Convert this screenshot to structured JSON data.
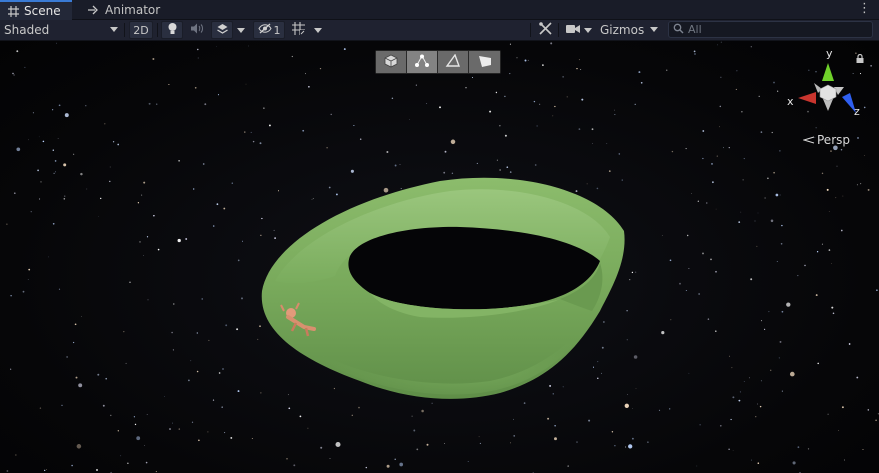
{
  "tabs": [
    {
      "label": "Scene",
      "icon": "grid-icon",
      "active": true
    },
    {
      "label": "Animator",
      "icon": "animator-icon",
      "active": false
    }
  ],
  "tab_menu_icon": "kebab-menu-icon",
  "toolbar": {
    "shading_mode": "Shaded",
    "mode_2d_label": "2D",
    "hidden_count": "1",
    "gizmos_label": "Gizmos",
    "search_placeholder": "All"
  },
  "tool_strip": [
    {
      "icon": "cube-icon",
      "selected": false
    },
    {
      "icon": "vertex-icon",
      "selected": true
    },
    {
      "icon": "edge-icon",
      "selected": false
    },
    {
      "icon": "face-icon",
      "selected": false
    }
  ],
  "gizmo": {
    "axis_x": "x",
    "axis_y": "y",
    "axis_z": "z",
    "projection_label": "Persp",
    "colors": {
      "x": "#c9352e",
      "y": "#6fd12a",
      "z": "#2f5ff0"
    }
  },
  "scene": {
    "object_color": "#7bab5e",
    "background": "#050507"
  }
}
